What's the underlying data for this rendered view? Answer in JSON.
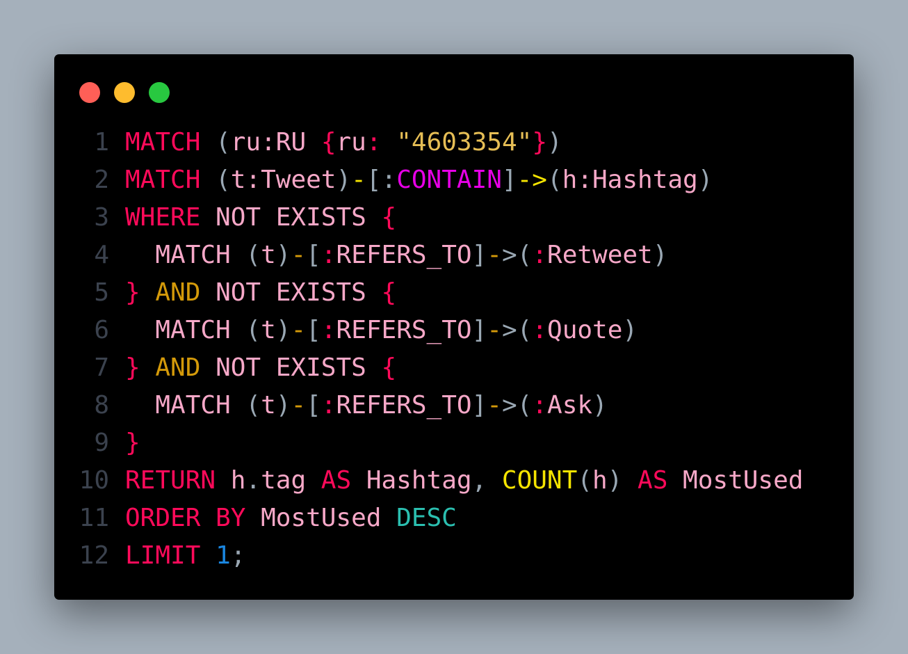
{
  "window": {
    "controls": [
      {
        "name": "close",
        "color": "#ff5f57"
      },
      {
        "name": "minimize",
        "color": "#febc2e"
      },
      {
        "name": "maximize",
        "color": "#28c840"
      }
    ]
  },
  "code": {
    "lines": [
      {
        "n": "1",
        "tokens": [
          {
            "t": "MATCH",
            "c": "kw"
          },
          {
            "t": " ",
            "c": "p"
          },
          {
            "t": "(",
            "c": "p"
          },
          {
            "t": "ru:RU",
            "c": "id"
          },
          {
            "t": " ",
            "c": "p"
          },
          {
            "t": "{",
            "c": "kw"
          },
          {
            "t": "ru",
            "c": "id"
          },
          {
            "t": ":",
            "c": "kw"
          },
          {
            "t": " ",
            "c": "p"
          },
          {
            "t": "\"4603354\"",
            "c": "s"
          },
          {
            "t": "}",
            "c": "kw"
          },
          {
            "t": ")",
            "c": "p"
          }
        ]
      },
      {
        "n": "2",
        "tokens": [
          {
            "t": "MATCH",
            "c": "kw"
          },
          {
            "t": " ",
            "c": "p"
          },
          {
            "t": "(",
            "c": "p"
          },
          {
            "t": "t:Tweet",
            "c": "id"
          },
          {
            "t": ")",
            "c": "p"
          },
          {
            "t": "-",
            "c": "y"
          },
          {
            "t": "[:",
            "c": "p"
          },
          {
            "t": "CONTAIN",
            "c": "m"
          },
          {
            "t": "]",
            "c": "p"
          },
          {
            "t": "->",
            "c": "y"
          },
          {
            "t": "(",
            "c": "p"
          },
          {
            "t": "h:Hashtag",
            "c": "id"
          },
          {
            "t": ")",
            "c": "p"
          }
        ]
      },
      {
        "n": "3",
        "tokens": [
          {
            "t": "WHERE",
            "c": "kw"
          },
          {
            "t": " NOT EXISTS ",
            "c": "id"
          },
          {
            "t": "{",
            "c": "kw"
          }
        ]
      },
      {
        "n": "4",
        "tokens": [
          {
            "t": "  MATCH ",
            "c": "id"
          },
          {
            "t": "(",
            "c": "p"
          },
          {
            "t": "t",
            "c": "id"
          },
          {
            "t": ")",
            "c": "p"
          },
          {
            "t": "-",
            "c": "o"
          },
          {
            "t": "[",
            "c": "p"
          },
          {
            "t": ":",
            "c": "kw"
          },
          {
            "t": "REFERS_TO",
            "c": "id"
          },
          {
            "t": "]",
            "c": "p"
          },
          {
            "t": "-",
            "c": "o"
          },
          {
            "t": ">(",
            "c": "p"
          },
          {
            "t": ":",
            "c": "kw"
          },
          {
            "t": "Retweet",
            "c": "id"
          },
          {
            "t": ")",
            "c": "p"
          }
        ]
      },
      {
        "n": "5",
        "tokens": [
          {
            "t": "}",
            "c": "kw"
          },
          {
            "t": " AND",
            "c": "o"
          },
          {
            "t": " NOT EXISTS ",
            "c": "id"
          },
          {
            "t": "{",
            "c": "kw"
          }
        ]
      },
      {
        "n": "6",
        "tokens": [
          {
            "t": "  MATCH ",
            "c": "id"
          },
          {
            "t": "(",
            "c": "p"
          },
          {
            "t": "t",
            "c": "id"
          },
          {
            "t": ")",
            "c": "p"
          },
          {
            "t": "-",
            "c": "o"
          },
          {
            "t": "[",
            "c": "p"
          },
          {
            "t": ":",
            "c": "kw"
          },
          {
            "t": "REFERS_TO",
            "c": "id"
          },
          {
            "t": "]",
            "c": "p"
          },
          {
            "t": "-",
            "c": "o"
          },
          {
            "t": ">(",
            "c": "p"
          },
          {
            "t": ":",
            "c": "kw"
          },
          {
            "t": "Quote",
            "c": "id"
          },
          {
            "t": ")",
            "c": "p"
          }
        ]
      },
      {
        "n": "7",
        "tokens": [
          {
            "t": "}",
            "c": "kw"
          },
          {
            "t": " AND",
            "c": "o"
          },
          {
            "t": " NOT EXISTS ",
            "c": "id"
          },
          {
            "t": "{",
            "c": "kw"
          }
        ]
      },
      {
        "n": "8",
        "tokens": [
          {
            "t": "  MATCH ",
            "c": "id"
          },
          {
            "t": "(",
            "c": "p"
          },
          {
            "t": "t",
            "c": "id"
          },
          {
            "t": ")",
            "c": "p"
          },
          {
            "t": "-",
            "c": "o"
          },
          {
            "t": "[",
            "c": "p"
          },
          {
            "t": ":",
            "c": "kw"
          },
          {
            "t": "REFERS_TO",
            "c": "id"
          },
          {
            "t": "]",
            "c": "p"
          },
          {
            "t": "-",
            "c": "o"
          },
          {
            "t": ">(",
            "c": "p"
          },
          {
            "t": ":",
            "c": "kw"
          },
          {
            "t": "Ask",
            "c": "id"
          },
          {
            "t": ")",
            "c": "p"
          }
        ]
      },
      {
        "n": "9",
        "tokens": [
          {
            "t": "}",
            "c": "kw"
          }
        ]
      },
      {
        "n": "10",
        "tokens": [
          {
            "t": "RETURN",
            "c": "kw"
          },
          {
            "t": " h",
            "c": "id"
          },
          {
            "t": ".",
            "c": "p"
          },
          {
            "t": "tag",
            "c": "id"
          },
          {
            "t": " AS",
            "c": "kw"
          },
          {
            "t": " Hashtag",
            "c": "id"
          },
          {
            "t": ", ",
            "c": "p"
          },
          {
            "t": "COUNT",
            "c": "y"
          },
          {
            "t": "(",
            "c": "p"
          },
          {
            "t": "h",
            "c": "id"
          },
          {
            "t": ")",
            "c": "p"
          },
          {
            "t": " AS",
            "c": "kw"
          },
          {
            "t": " MostUsed",
            "c": "id"
          }
        ]
      },
      {
        "n": "11",
        "tokens": [
          {
            "t": "ORDER BY",
            "c": "kw"
          },
          {
            "t": " MostUsed",
            "c": "id"
          },
          {
            "t": " DESC",
            "c": "te"
          }
        ]
      },
      {
        "n": "12",
        "tokens": [
          {
            "t": "LIMIT",
            "c": "kw"
          },
          {
            "t": " ",
            "c": "p"
          },
          {
            "t": "1",
            "c": "b"
          },
          {
            "t": ";",
            "c": "p"
          }
        ]
      }
    ]
  }
}
